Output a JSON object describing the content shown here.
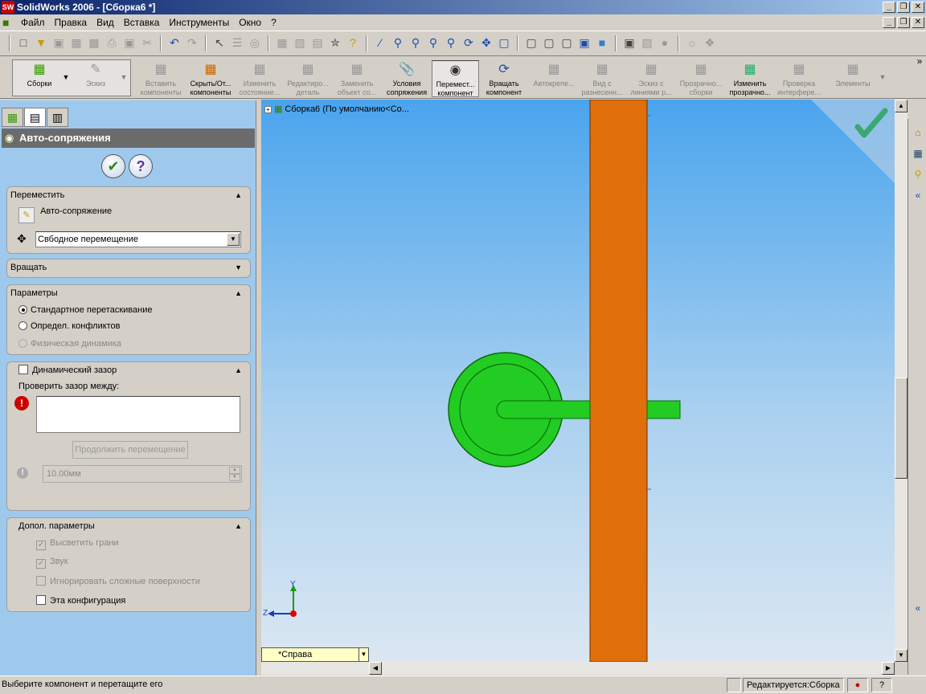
{
  "window": {
    "title": "SolidWorks 2006 - [Сборка6 *]",
    "app_icon": "SW",
    "min": "_",
    "restore": "❐",
    "close": "✕"
  },
  "menu": {
    "items": [
      "Файл",
      "Правка",
      "Вид",
      "Вставка",
      "Инструменты",
      "Окно",
      "?"
    ]
  },
  "cmdbar": {
    "sborki": "Сборки",
    "eskiz": "Эскиз",
    "commands": [
      {
        "label1": "Вставить",
        "label2": "компоненты",
        "enabled": false
      },
      {
        "label1": "Скрыть/От...",
        "label2": "компоненты",
        "enabled": true
      },
      {
        "label1": "Изменить",
        "label2": "состояние...",
        "enabled": false
      },
      {
        "label1": "Редактиро...",
        "label2": "деталь",
        "enabled": false
      },
      {
        "label1": "Заменить",
        "label2": "объект со...",
        "enabled": false
      },
      {
        "label1": "Условия",
        "label2": "сопряжения",
        "enabled": true
      },
      {
        "label1": "Перемест...",
        "label2": "компонент",
        "enabled": true
      },
      {
        "label1": "Вращать",
        "label2": "компонент",
        "enabled": true
      },
      {
        "label1": "Автокрепе...",
        "label2": "",
        "enabled": false
      },
      {
        "label1": "Вид с",
        "label2": "разнесенн...",
        "enabled": false
      },
      {
        "label1": "Эскиз с",
        "label2": "линиями р...",
        "enabled": false
      },
      {
        "label1": "Прозрачно...",
        "label2": "сборки",
        "enabled": false
      },
      {
        "label1": "Изменить",
        "label2": "прозрачно...",
        "enabled": true
      },
      {
        "label1": "Проверка",
        "label2": "интерфере...",
        "enabled": false
      }
    ],
    "elementy": "Элементы",
    "more": "»"
  },
  "pm": {
    "title": "Авто-сопряжения",
    "ok": "✔",
    "help": "?",
    "move": {
      "header": "Переместить",
      "automate_label": "Авто-сопряжение",
      "mode_value": "Свбодное перемещение"
    },
    "rotate": {
      "header": "Вращать"
    },
    "params": {
      "header": "Параметры",
      "opt1": "Стандартное перетаскивание",
      "opt2": "Определ. конфликтов",
      "opt3": "Физическая динамика"
    },
    "clearance": {
      "header": "Динамический зазор",
      "check_label": "Проверить зазор между:",
      "continue_btn": "Продолжить перемещение",
      "distance": "10.00мм"
    },
    "extra": {
      "header": "Допол. параметры",
      "opt1": "Высветить грани",
      "opt2": "Звук",
      "opt3": "Игнорировать сложные поверхности",
      "opt4": "Эта конфигурация"
    }
  },
  "viewport": {
    "tree_root": "Сборка6  (По умолчанию<Со...",
    "view_name": "*Справа",
    "axis_y": "Y",
    "axis_z": "Z",
    "colors": {
      "beam": "#e06e0a",
      "part": "#22cc22",
      "part_outline": "#0a6a0a"
    }
  },
  "status": {
    "message": "Выберите компонент и перетащите его",
    "editing": "Редактируется:Сборка",
    "help": "?"
  }
}
